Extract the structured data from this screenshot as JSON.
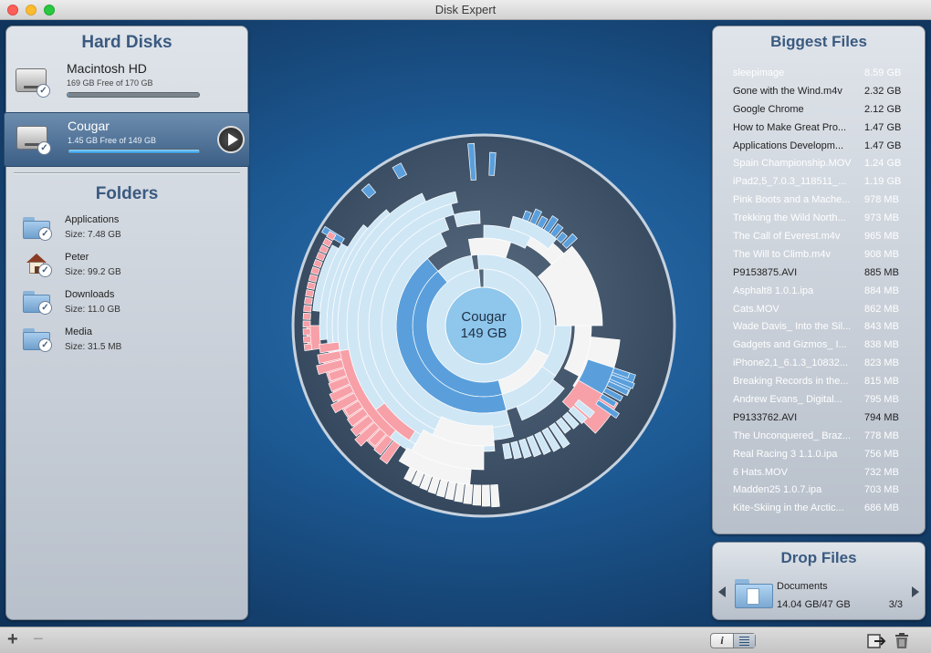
{
  "window": {
    "title": "Disk Expert"
  },
  "hard_disks": {
    "title": "Hard Disks",
    "items": [
      {
        "name": "Macintosh HD",
        "free_text": "169 GB Free of 170 GB",
        "used_fraction": 0.006,
        "selected": false
      },
      {
        "name": "Cougar",
        "free_text": "1.45 GB Free of 149 GB",
        "used_fraction": 0.99,
        "selected": true
      }
    ]
  },
  "folders": {
    "title": "Folders",
    "items": [
      {
        "name": "Applications",
        "size": "Size: 7.48 GB",
        "icon": "applications-folder-icon"
      },
      {
        "name": "Peter",
        "size": "Size: 99.2 GB",
        "icon": "home-icon"
      },
      {
        "name": "Downloads",
        "size": "Size: 11.0 GB",
        "icon": "downloads-folder-icon"
      },
      {
        "name": "Media",
        "size": "Size: 31.5 MB",
        "icon": "folder-icon"
      }
    ]
  },
  "center": {
    "name": "Cougar",
    "size": "149 GB"
  },
  "colors": {
    "accent": "#5a9fdc",
    "light": "#cfe6f5",
    "pink": "#f7a0a8",
    "white": "#f4f4f4",
    "highlight_row": "#ffffff"
  },
  "biggest_files": {
    "title": "Biggest Files",
    "items": [
      {
        "name": "sleepimage",
        "size": "8.59 GB",
        "hl": true
      },
      {
        "name": "Gone with the Wind.m4v",
        "size": "2.32 GB",
        "hl": false
      },
      {
        "name": "Google Chrome",
        "size": "2.12 GB",
        "hl": false
      },
      {
        "name": "How to Make Great Pro...",
        "size": "1.47 GB",
        "hl": false
      },
      {
        "name": "Applications Developm...",
        "size": "1.47 GB",
        "hl": false
      },
      {
        "name": "Spain Championship.MOV",
        "size": "1.24 GB",
        "hl": true
      },
      {
        "name": "iPad2,5_7.0.3_118511_...",
        "size": "1.19 GB",
        "hl": true
      },
      {
        "name": "Pink Boots and a Mache...",
        "size": "978 MB",
        "hl": true
      },
      {
        "name": "Trekking the Wild North...",
        "size": "973 MB",
        "hl": true
      },
      {
        "name": "The Call of Everest.m4v",
        "size": "965 MB",
        "hl": true
      },
      {
        "name": "The Will to Climb.m4v",
        "size": "908 MB",
        "hl": true
      },
      {
        "name": "P9153875.AVI",
        "size": "885 MB",
        "hl": false
      },
      {
        "name": "Asphalt8 1.0.1.ipa",
        "size": "884 MB",
        "hl": true
      },
      {
        "name": "Cats.MOV",
        "size": "862 MB",
        "hl": true
      },
      {
        "name": "Wade Davis_ Into the Sil...",
        "size": "843 MB",
        "hl": true
      },
      {
        "name": "Gadgets and Gizmos_ I...",
        "size": "838 MB",
        "hl": true
      },
      {
        "name": "iPhone2,1_6.1.3_10832...",
        "size": "823 MB",
        "hl": true
      },
      {
        "name": "Breaking Records in the...",
        "size": "815 MB",
        "hl": true
      },
      {
        "name": "Andrew Evans_ Digital...",
        "size": "795 MB",
        "hl": true
      },
      {
        "name": "P9133762.AVI",
        "size": "794 MB",
        "hl": false
      },
      {
        "name": "The Unconquered_ Braz...",
        "size": "778 MB",
        "hl": true
      },
      {
        "name": "Real Racing 3 1.1.0.ipa",
        "size": "756 MB",
        "hl": true
      },
      {
        "name": "6 Hats.MOV",
        "size": "732 MB",
        "hl": true
      },
      {
        "name": "Madden25 1.0.7.ipa",
        "size": "703 MB",
        "hl": true
      },
      {
        "name": "Kite-Skiing in the Arctic...",
        "size": "686 MB",
        "hl": true
      }
    ]
  },
  "drop_files": {
    "title": "Drop Files",
    "item_name": "Documents",
    "item_size": "14.04 GB/47 GB",
    "pager": "3/3"
  },
  "toolbar": {
    "add": "+",
    "remove": "−",
    "info": "i"
  }
}
